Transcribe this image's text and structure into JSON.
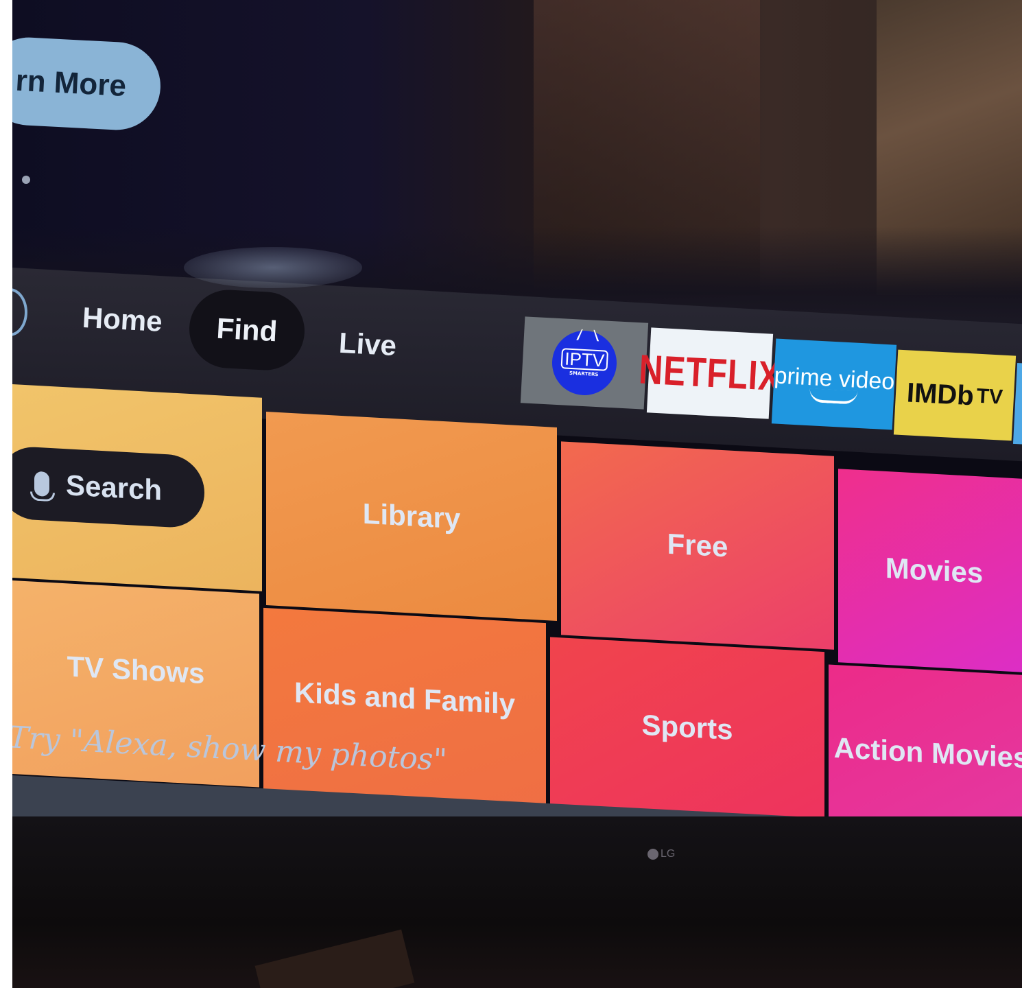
{
  "hero": {
    "learn_more_label": "rn More"
  },
  "nav": {
    "items": [
      {
        "label": "Home"
      },
      {
        "label": "Find",
        "selected": true
      },
      {
        "label": "Live"
      }
    ]
  },
  "apps": [
    {
      "name": "IPTV Smarters",
      "logo_text": "IPTV",
      "logo_subtext": "SMARTERS"
    },
    {
      "name": "Netflix",
      "logo_text": "NETFLIX"
    },
    {
      "name": "Prime Video",
      "logo_text": "prime video"
    },
    {
      "name": "IMDb TV",
      "logo_text": "IMDb",
      "logo_suffix": "TV"
    }
  ],
  "grid": {
    "search_label": "Search",
    "tiles": [
      {
        "label": "Library"
      },
      {
        "label": "Free"
      },
      {
        "label": "Movies"
      },
      {
        "label": "TV Shows"
      },
      {
        "label": "Kids and Family"
      },
      {
        "label": "Sports"
      },
      {
        "label": "Action Movies"
      }
    ]
  },
  "hint": "Try \"Alexa, show my photos\"",
  "tv_brand": "LG",
  "colors": {
    "netflix_red": "#d9202a",
    "prime_blue": "#1f97e0",
    "imdb_yellow": "#e9d24a",
    "iptv_blue": "#1a2fe0"
  }
}
